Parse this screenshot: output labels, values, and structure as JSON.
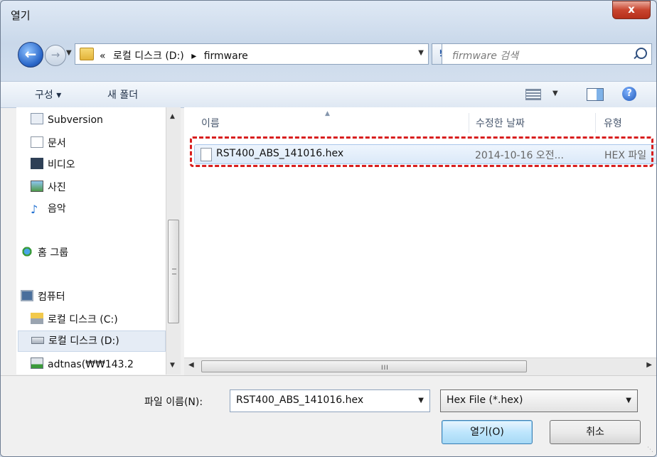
{
  "window": {
    "title": "열기",
    "close_label": "x"
  },
  "nav": {
    "breadcrumb": [
      "«",
      "로컬 디스크 (D:)",
      "▸",
      "firmware"
    ],
    "search_placeholder": "firmware 검색"
  },
  "toolbar": {
    "organize": "구성 ▾",
    "new_folder": "새 폴더"
  },
  "sidebar": {
    "items": [
      {
        "label": "Subversion",
        "icon": "svn-icon"
      },
      {
        "label": "문서",
        "icon": "documents-icon"
      },
      {
        "label": "비디오",
        "icon": "video-icon"
      },
      {
        "label": "사진",
        "icon": "pictures-icon"
      },
      {
        "label": "음악",
        "icon": "music-icon"
      },
      {
        "label": "홈 그룹",
        "icon": "homegroup-icon"
      },
      {
        "label": "컴퓨터",
        "icon": "computer-icon"
      },
      {
        "label": "로컬 디스크 (C:)",
        "icon": "drive-icon"
      },
      {
        "label": "로컬 디스크 (D:)",
        "icon": "drive-icon",
        "selected": true
      },
      {
        "label": "adtnas(₩₩143.2",
        "icon": "network-drive-icon"
      }
    ]
  },
  "columns": {
    "name": "이름",
    "modified": "수정한 날짜",
    "type": "유형"
  },
  "files": [
    {
      "name": "RST400_ABS_141016.hex",
      "modified": "2014-10-16 오전...",
      "type": "HEX 파일"
    }
  ],
  "footer": {
    "filename_label": "파일 이름(N):",
    "filename_value": "RST400_ABS_141016.hex",
    "filetype_value": "Hex File (*.hex)",
    "open_label": "열기(O)",
    "cancel_label": "취소"
  },
  "colors": {
    "highlight_border": "#d81e1e",
    "selection_bg": "#dbe9f9",
    "accent": "#2457a6"
  }
}
